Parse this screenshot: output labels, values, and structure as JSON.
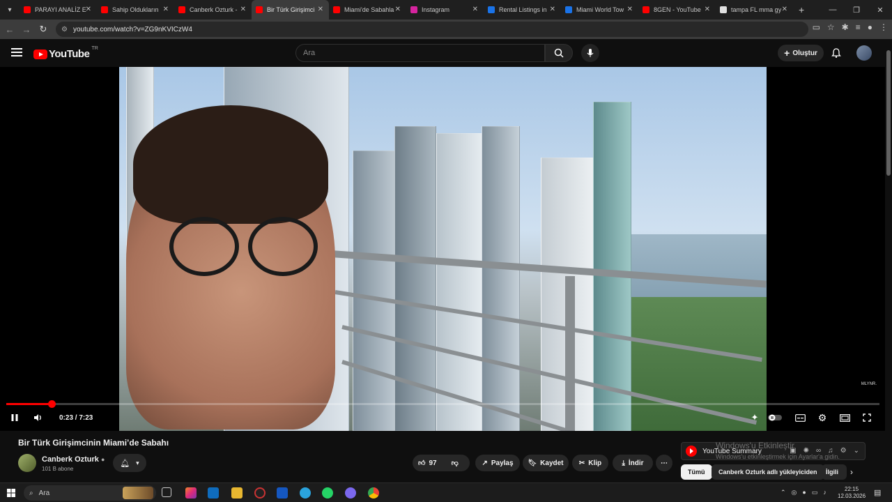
{
  "browser": {
    "tabs": [
      {
        "title": "PARAYI ANALİZ E",
        "color": "#ff0000"
      },
      {
        "title": "Sahip Oldukların",
        "color": "#ff0000"
      },
      {
        "title": "Canberk Ozturk -",
        "color": "#ff0000"
      },
      {
        "title": "Bir Türk Girişimci",
        "color": "#ff0000",
        "active": true
      },
      {
        "title": "Miami'de Sabahla",
        "color": "#ff0000"
      },
      {
        "title": "Instagram",
        "color": "#d6249f"
      },
      {
        "title": "Rental Listings in",
        "color": "#1a73e8"
      },
      {
        "title": "Miami World Tow",
        "color": "#1a73e8"
      },
      {
        "title": "8GEN - YouTube",
        "color": "#ff0000"
      },
      {
        "title": "tampa FL mma gy",
        "color": "#e0e0e0"
      }
    ],
    "url": "youtube.com/watch?v=ZG9nKVICzW4"
  },
  "header": {
    "logo_text": "YouTube",
    "country": "TR",
    "search_placeholder": "Ara",
    "create_label": "Oluştur"
  },
  "player": {
    "current_time": "0:23",
    "duration": "7:23",
    "time_display": "0:23 / 7:23",
    "progress": 0.052,
    "watermark": "MLYNR."
  },
  "video": {
    "title": "Bir Türk Girişimcinin Miami’de Sabahı",
    "channel": "Canberk Ozturk",
    "subscribers": "101 B abone",
    "likes": "97",
    "share_label": "Paylaş",
    "save_label": "Kaydet",
    "clip_label": "Klip",
    "download_label": "İndir"
  },
  "extension": {
    "name": "YouTube Summary"
  },
  "windows_activation": {
    "line1": "Windows'u Etkinleştir",
    "line2": "Windows'u etkinleştirmek için Ayarlar'a gidin."
  },
  "chips": {
    "all": "Tümü",
    "uploader": "Canberk Ozturk adlı yükleyiciden",
    "related": "İlgili"
  },
  "taskbar": {
    "search_placeholder": "Ara",
    "time": "22:15",
    "date": "12.03.2026"
  }
}
